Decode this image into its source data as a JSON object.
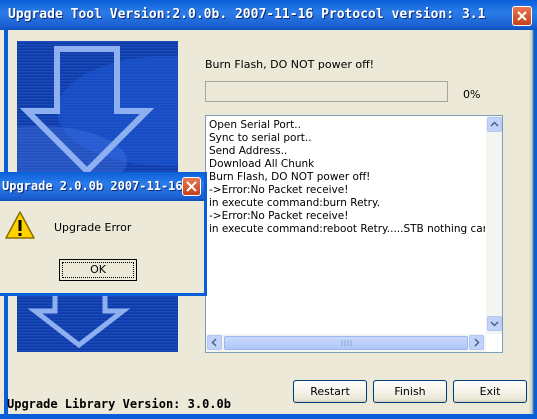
{
  "window": {
    "title": "Upgrade Tool Version:2.0.0b. 2007-11-16 Protocol version: 3.1"
  },
  "status": {
    "message": "Burn Flash, DO NOT power off!",
    "progress_percent": 0,
    "progress_text": "0%"
  },
  "log": {
    "lines": [
      "Open Serial Port..",
      "Sync to serial port..",
      "Send Address..",
      "Download All Chunk",
      "Burn Flash, DO NOT power off!",
      "->Error:No Packet receive!",
      " in execute command:burn Retry.",
      "->Error:No Packet receive!",
      " in execute command:reboot Retry.....STB nothing can bur"
    ]
  },
  "footer": {
    "library_version": "Upgrade Library Version: 3.0.0b"
  },
  "buttons": {
    "restart": "Restart",
    "finish": "Finish",
    "exit": "Exit"
  },
  "dialog": {
    "title": "Upgrade 2.0.0b 2007-11-16",
    "message": "Upgrade Error",
    "ok_label": "OK",
    "icon": "warning-icon"
  },
  "colors": {
    "titlebar": "#0a5fd8",
    "banner": "#0d3aa6",
    "close": "#c4411c"
  }
}
